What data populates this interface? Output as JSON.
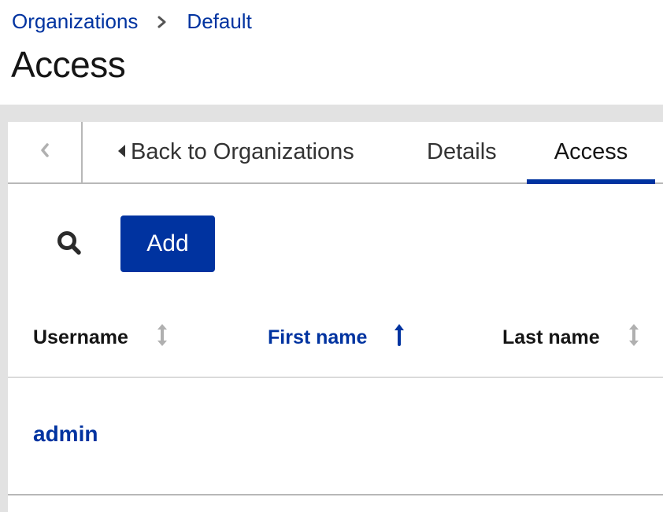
{
  "breadcrumb": {
    "items": [
      {
        "label": "Organizations"
      },
      {
        "label": "Default"
      }
    ],
    "separator_icon": "chevron-right-icon"
  },
  "page": {
    "title": "Access"
  },
  "tabs": {
    "scroll_icon": "chevron-left-icon",
    "items": [
      {
        "label": "Back to Organizations",
        "icon": "caret-left-icon",
        "active": false
      },
      {
        "label": "Details",
        "active": false
      },
      {
        "label": "Access",
        "active": true
      }
    ]
  },
  "toolbar": {
    "search_icon": "search-icon",
    "add_label": "Add"
  },
  "table": {
    "columns": [
      {
        "label": "Username",
        "sort": "none",
        "sort_icon": "sort-icon"
      },
      {
        "label": "First name",
        "sort": "ascending",
        "sort_icon": "sort-ascending-icon"
      },
      {
        "label": "Last name",
        "sort": "none",
        "sort_icon": "sort-icon"
      }
    ],
    "rows": [
      {
        "username": "admin",
        "first_name": "",
        "last_name": ""
      }
    ]
  },
  "colors": {
    "accent": "#0033a0",
    "text": "#151515",
    "border": "#b8b8b8",
    "background": "#e2e2e2"
  }
}
